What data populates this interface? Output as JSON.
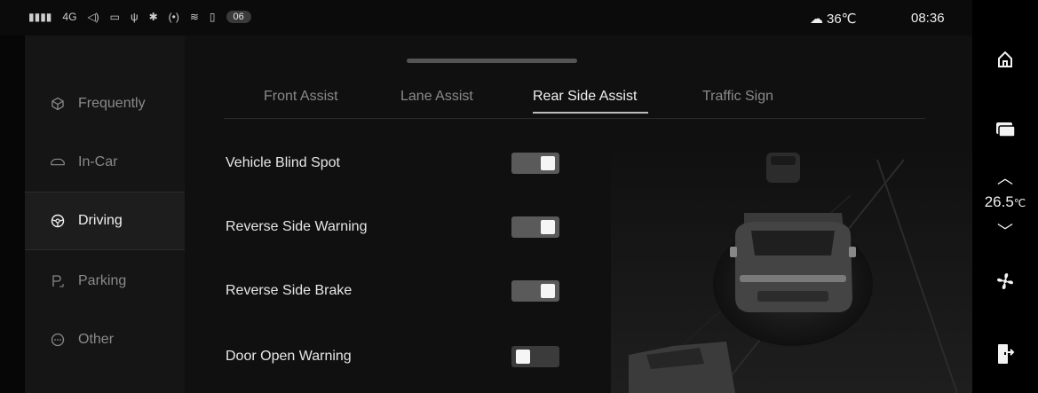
{
  "status_bar": {
    "signal": "4G",
    "badge": "06",
    "weather_temp": "36℃",
    "time": "08:36"
  },
  "sidebar": {
    "items": [
      {
        "label": "Frequently",
        "icon": "cube-icon",
        "active": false
      },
      {
        "label": "In-Car",
        "icon": "car-icon",
        "active": false
      },
      {
        "label": "Driving",
        "icon": "steering-wheel-icon",
        "active": true
      },
      {
        "label": "Parking",
        "icon": "parking-icon",
        "active": false
      },
      {
        "label": "Other",
        "icon": "more-icon",
        "active": false
      }
    ]
  },
  "tabs": [
    {
      "label": "Front Assist",
      "active": false
    },
    {
      "label": "Lane Assist",
      "active": false
    },
    {
      "label": "Rear Side Assist",
      "active": true
    },
    {
      "label": "Traffic Sign",
      "active": false
    }
  ],
  "settings": [
    {
      "label": "Vehicle Blind Spot",
      "on": true
    },
    {
      "label": "Reverse Side Warning",
      "on": true
    },
    {
      "label": "Reverse Side Brake",
      "on": true
    },
    {
      "label": "Door Open Warning",
      "on": false
    }
  ],
  "dock": {
    "temp_value": "26.5",
    "temp_unit": "℃"
  },
  "colors": {
    "background": "#060606",
    "panel": "#101010",
    "sidebar": "#151515",
    "toggle_on": "#5a5a5a",
    "toggle_off": "#3b3b3b"
  }
}
